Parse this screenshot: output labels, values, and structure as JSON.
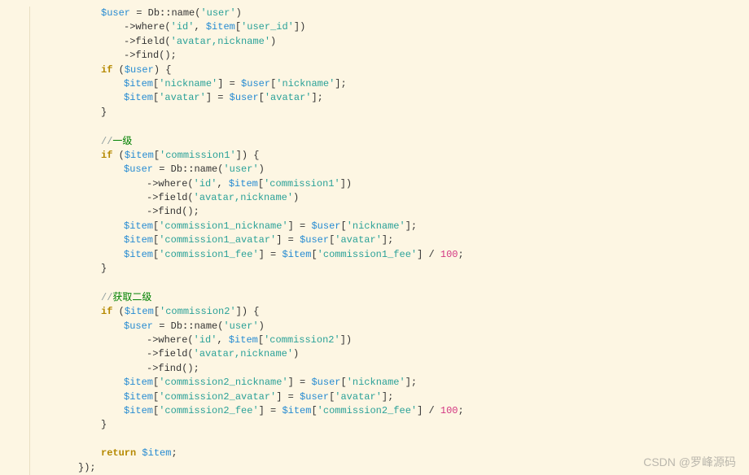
{
  "watermark": "CSDN @罗峰源码",
  "code": {
    "vars": {
      "user": "$user",
      "item": "$item"
    },
    "class": "Db",
    "methods": {
      "name": "name",
      "where": "where",
      "field": "field",
      "find": "find"
    },
    "strings": {
      "user": "'user'",
      "id": "'id'",
      "user_id": "'user_id'",
      "avatar_nickname": "'avatar,nickname'",
      "nickname": "'nickname'",
      "avatar": "'avatar'",
      "commission1": "'commission1'",
      "commission1_nickname": "'commission1_nickname'",
      "commission1_avatar": "'commission1_avatar'",
      "commission1_fee": "'commission1_fee'",
      "commission2": "'commission2'",
      "commission2_nickname": "'commission2_nickname'",
      "commission2_avatar": "'commission2_avatar'",
      "commission2_fee": "'commission2_fee'"
    },
    "keywords": {
      "if": "if",
      "return": "return"
    },
    "numbers": {
      "hundred": "100"
    },
    "comments": {
      "level1": "一级",
      "level2": "获取二级"
    },
    "symbols": {
      "arrow": "->",
      "scope": "::",
      "assign": " = ",
      "open_paren": "(",
      "close_paren": ")",
      "open_brace": "{",
      "close_brace": "}",
      "open_bracket": "[",
      "close_bracket": "]",
      "semi": ";",
      "comma": ", ",
      "div": " / ",
      "close_paren_semi": "();",
      "close_paren_brace": ") {",
      "close_all": "});",
      "slashes": "//"
    }
  }
}
